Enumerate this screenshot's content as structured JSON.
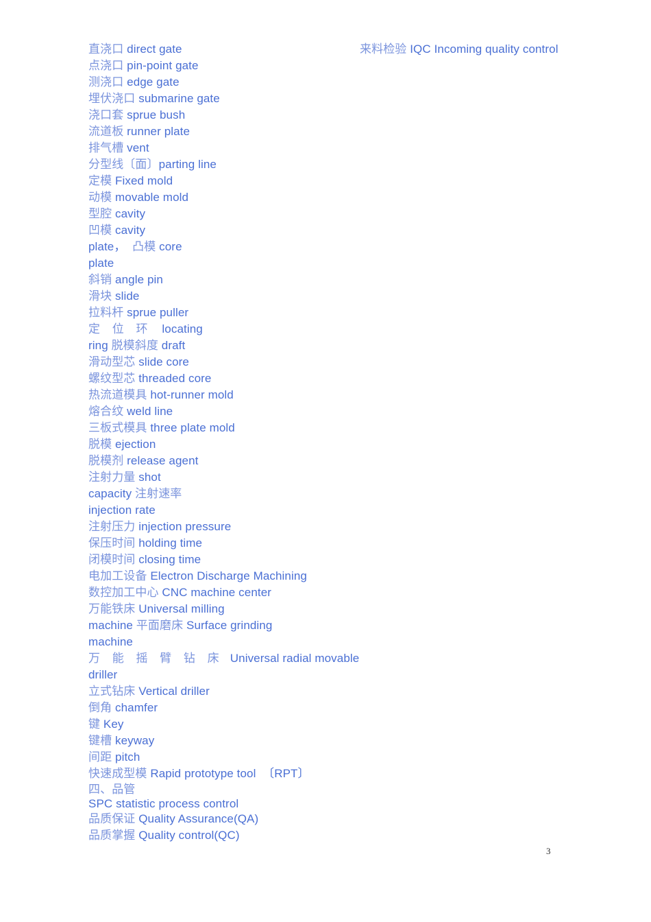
{
  "page": {
    "number": "3",
    "background_color": "#ffffff",
    "chinese_text_color": "#7b94dd",
    "english_text_color": "#4a6fd4",
    "page_number_color": "#2b2b2b"
  },
  "left_column": {
    "lines": [
      {
        "cn": "直浇口",
        "en": " direct gate"
      },
      {
        "cn": "点浇口",
        "en": " pin-point gate"
      },
      {
        "cn": "测浇口",
        "en": " edge gate"
      },
      {
        "cn": "埋伏浇口",
        "en": " submarine gate"
      },
      {
        "cn": "浇口套",
        "en": " sprue bush"
      },
      {
        "cn": "流道板",
        "en": " runner plate"
      },
      {
        "cn": "排气槽",
        "en": " vent"
      },
      {
        "cn": "分型线〔面〕",
        "en": "parting line"
      },
      {
        "cn": "定模",
        "en": " Fixed mold"
      },
      {
        "cn": "动模",
        "en": " movable mold"
      },
      {
        "cn": "型腔",
        "en": " cavity"
      },
      {
        "cn": "凹模",
        "en": " cavity"
      },
      {
        "cn": "",
        "en": "plate，",
        "cn2": "  凸模",
        "en2": " core"
      },
      {
        "cn": "",
        "en": "plate"
      },
      {
        "cn": "斜销",
        "en": " angle pin"
      },
      {
        "cn": "滑块",
        "en": " slide"
      },
      {
        "cn": "拉料杆",
        "en": " sprue puller"
      },
      {
        "cn": "定 位 环",
        "en": "   locating",
        "spaced": true
      },
      {
        "cn": "",
        "en": "ring ",
        "cn2": "脱模斜度",
        "en2": " draft"
      },
      {
        "cn": "滑动型芯",
        "en": " slide core"
      },
      {
        "cn": "螺纹型芯",
        "en": " threaded core"
      },
      {
        "cn": "热流道模具",
        "en": " hot-runner mold"
      },
      {
        "cn": "熔合纹",
        "en": " weld line"
      },
      {
        "cn": "三板式模具",
        "en": " three plate mold"
      },
      {
        "cn": "脱模",
        "en": " ejection"
      },
      {
        "cn": "脱模剂",
        "en": " release agent"
      },
      {
        "cn": "注射力量",
        "en": " shot"
      },
      {
        "cn": "",
        "en": "capacity ",
        "cn2": "注射速率",
        "en2": ""
      },
      {
        "cn": "",
        "en": "injection rate"
      },
      {
        "cn": "注射压力",
        "en": " injection pressure"
      },
      {
        "cn": "保压时间",
        "en": " holding time"
      },
      {
        "cn": "闭模时间",
        "en": " closing time"
      },
      {
        "cn": "电加工设备",
        "en": " Electron Discharge Machining"
      },
      {
        "cn": "数控加工中心",
        "en": " CNC machine center"
      },
      {
        "cn": "万能铁床",
        "en": " Universal milling"
      },
      {
        "cn": "",
        "en": "machine ",
        "cn2": "平面磨床",
        "en2": " Surface grinding"
      },
      {
        "cn": "",
        "en": "machine"
      },
      {
        "cn": "万 能 摇 臂 钻 床",
        "en": "  Universal radial movable",
        "spaced": true
      },
      {
        "cn": "",
        "en": "driller"
      },
      {
        "cn": "立式钻床",
        "en": " Vertical driller"
      },
      {
        "cn": "倒角",
        "en": " chamfer"
      },
      {
        "cn": "键",
        "en": " Key"
      },
      {
        "cn": "键槽",
        "en": " keyway"
      },
      {
        "cn": "间距",
        "en": " pitch"
      },
      {
        "cn": "快速成型模",
        "en": " Rapid prototype tool  〔RPT〕"
      },
      {
        "cn": "四、品管",
        "en": "",
        "tight": true
      },
      {
        "cn": "",
        "en": "SPC statistic process control",
        "tight": true
      },
      {
        "cn": "品质保证",
        "en": " Quality Assurance(QA)"
      },
      {
        "cn": "品质掌握",
        "en": " Quality control(QC)"
      }
    ]
  },
  "right_column": {
    "lines": [
      {
        "cn": "来料检验",
        "en": " IQC Incoming quality control"
      }
    ]
  }
}
